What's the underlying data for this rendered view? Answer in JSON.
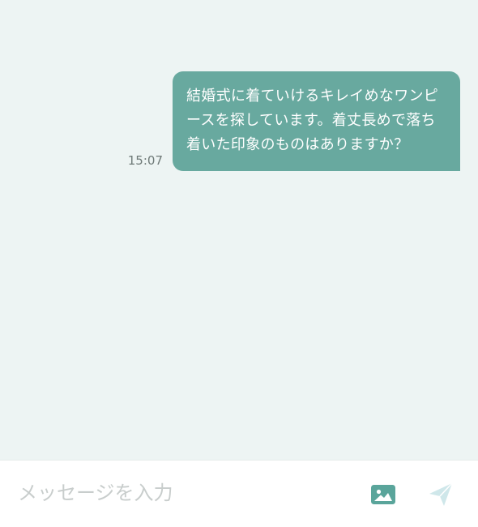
{
  "chat": {
    "messages": [
      {
        "sender": "self",
        "text": "結婚式に着ていけるキレイめなワンピースを探しています。着丈長めで落ち着いた印象のものはありますか？",
        "time": "15:07"
      }
    ]
  },
  "composer": {
    "placeholder": "メッセージを入力",
    "value": "",
    "image_icon": "image-icon",
    "send_icon": "send-icon"
  },
  "colors": {
    "background": "#edf4f3",
    "bubble": "#68a99f",
    "image_icon": "#5aa59b",
    "send_icon_disabled": "#cfe7ea"
  }
}
